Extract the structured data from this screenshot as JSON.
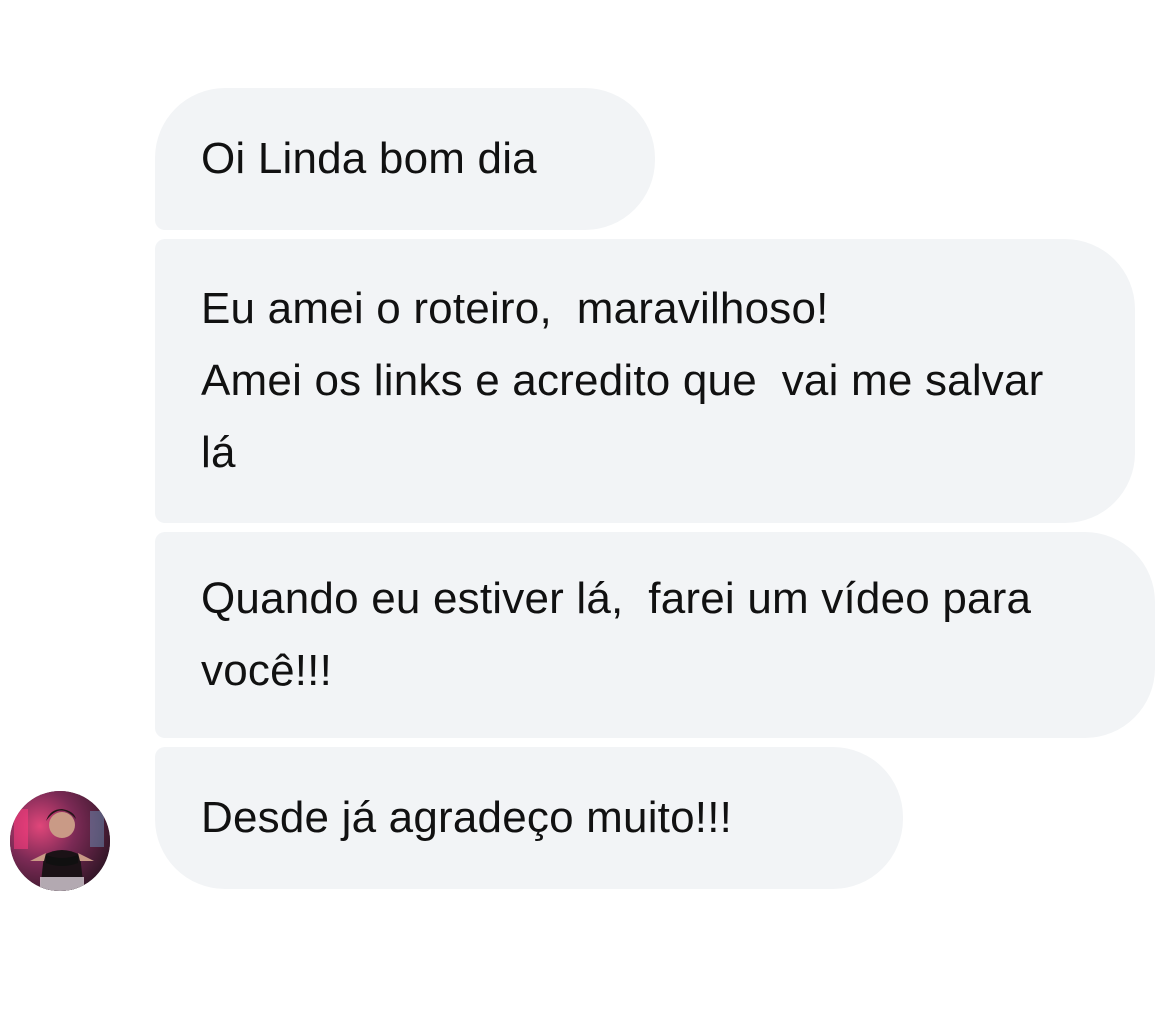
{
  "conversation": {
    "messages": [
      {
        "text": "Oi Linda bom dia"
      },
      {
        "text": "Eu amei o roteiro,  maravilhoso!\nAmei os links e acredito que  vai me salvar lá"
      },
      {
        "text": "Quando eu estiver lá,  farei um vídeo para você!!!"
      },
      {
        "text": "Desde já agradeço muito!!!"
      }
    ],
    "sender": {
      "avatar_icon": "profile-photo-avatar"
    }
  },
  "colors": {
    "bubble_background": "#f2f4f6",
    "text": "#111111",
    "background": "#ffffff"
  }
}
